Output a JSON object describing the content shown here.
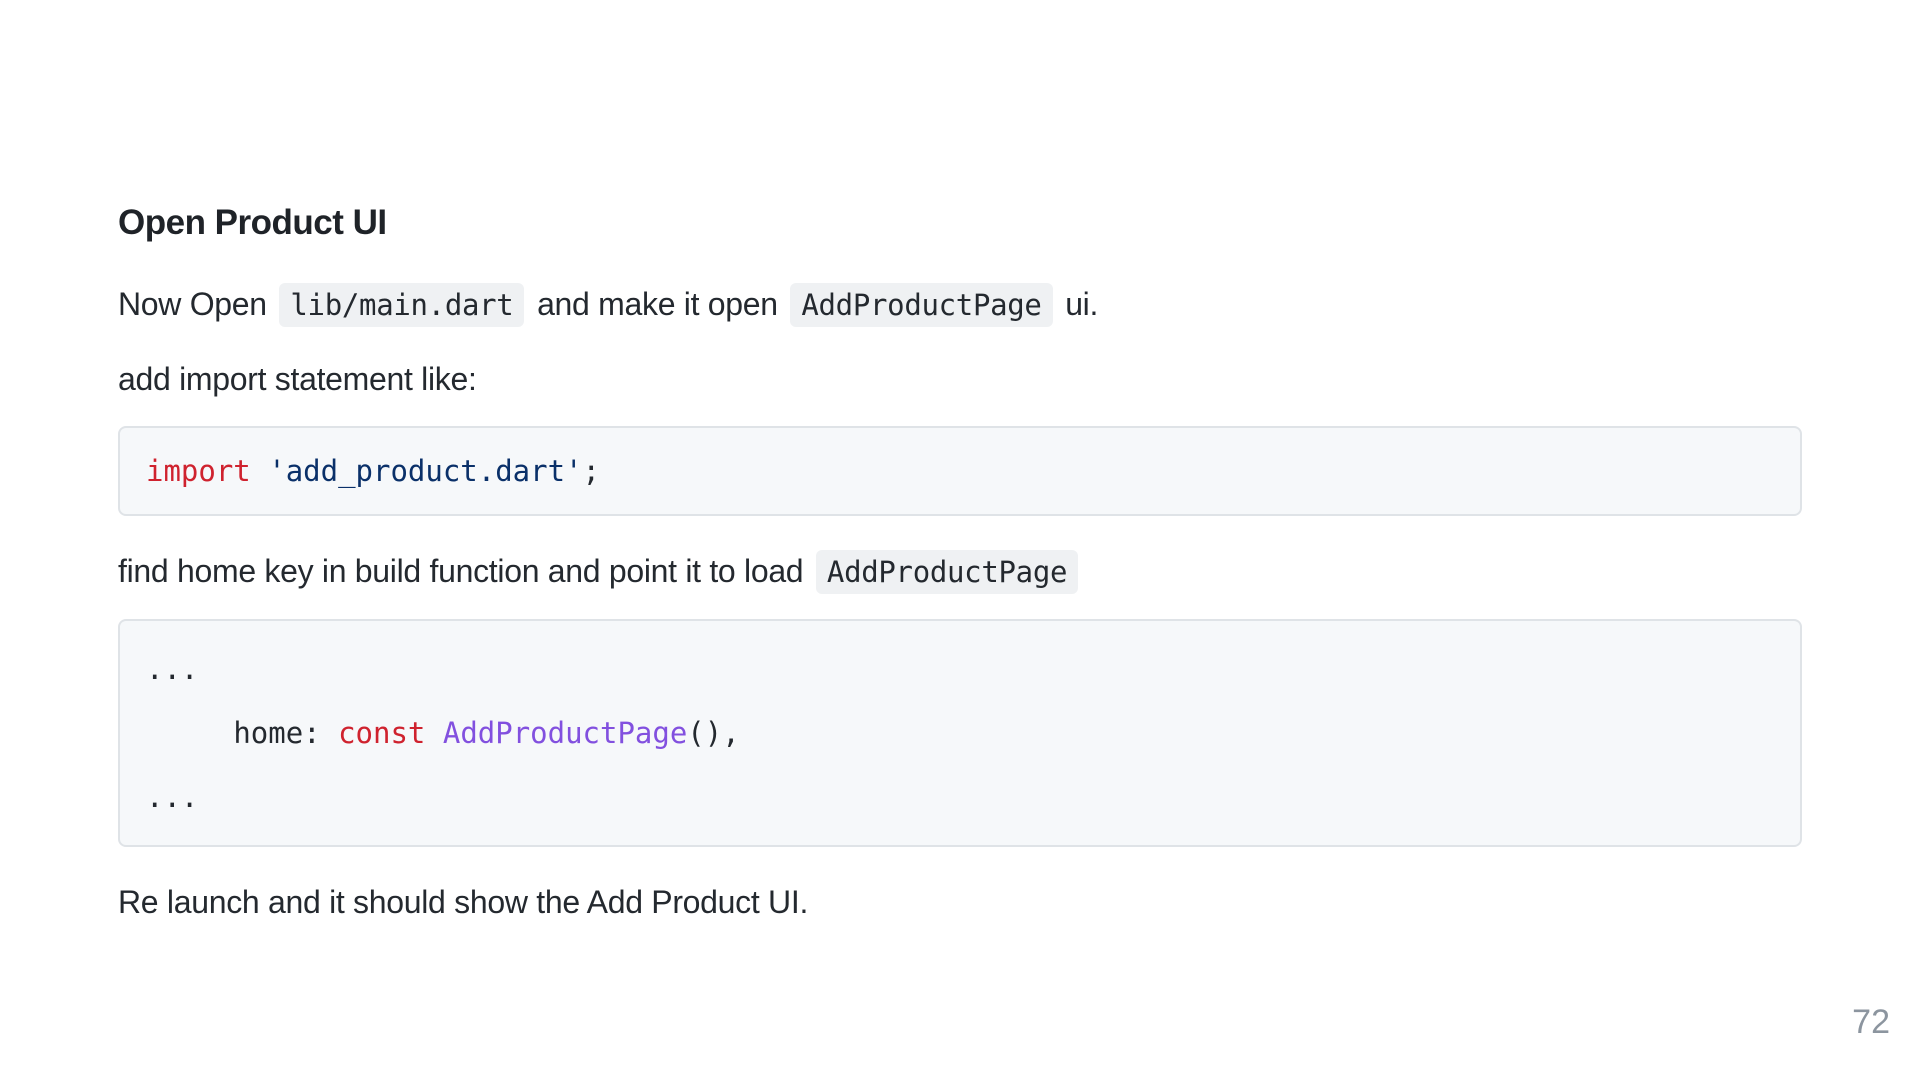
{
  "heading": "Open Product UI",
  "para1": {
    "text_a": "Now Open",
    "code_a": "lib/main.dart",
    "text_b": "and make it open",
    "code_b": "AddProductPage",
    "text_c": "ui."
  },
  "para2": "add import statement like:",
  "code_block1": {
    "keyword": "import",
    "string": "'add_product.dart'",
    "punct": ";"
  },
  "para3": {
    "text": "find home key in build function and point it to load",
    "code": "AddProductPage"
  },
  "code_block2": {
    "ellipsis_top": "...",
    "indent": "     ",
    "key": "home: ",
    "keyword": "const",
    "class_name": "AddProductPage",
    "tail": "(),",
    "ellipsis_bottom": "..."
  },
  "para4": "Re launch and it should show the Add Product UI.",
  "page_number": "72"
}
